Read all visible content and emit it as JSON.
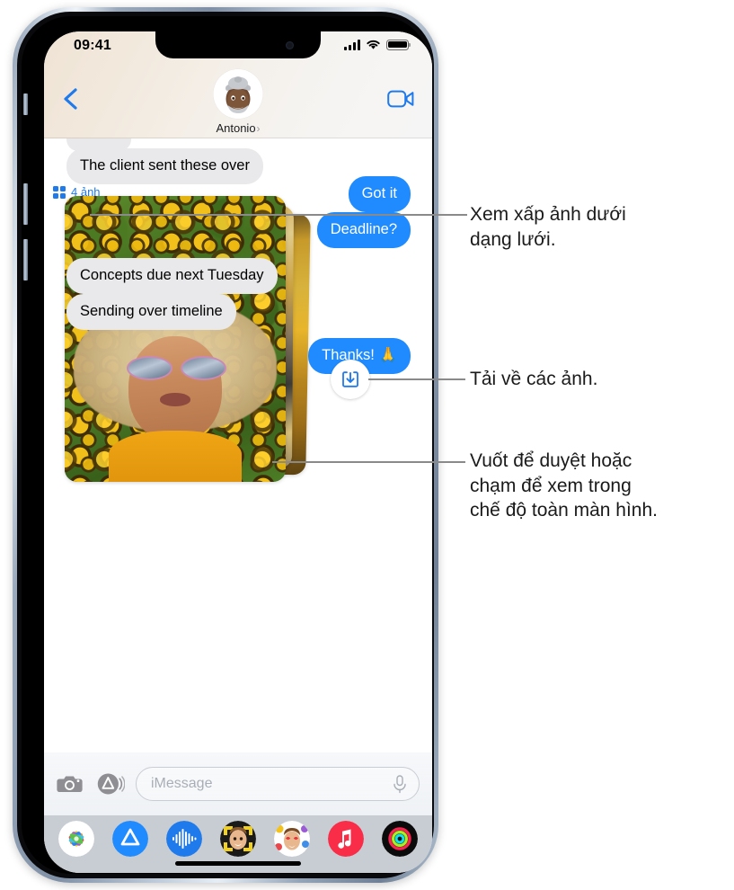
{
  "status_bar": {
    "time": "09:41",
    "signal_icon": "cellular-signal-icon",
    "wifi_icon": "wifi-icon",
    "battery_icon": "battery-icon"
  },
  "nav_bar": {
    "back_icon": "back-chevron-icon",
    "facetime_icon": "facetime-video-icon",
    "contact_name": "Antonio",
    "contact_chevron": "›",
    "avatar_icon": "memoji-avatar-icon"
  },
  "conversation": {
    "messages": [
      {
        "id": "cut",
        "text": "",
        "side": "in",
        "partial": true
      },
      {
        "id": "m1",
        "text": "The client sent these over",
        "side": "in"
      },
      {
        "id": "m2",
        "text": "Got it",
        "side": "out"
      },
      {
        "id": "m3",
        "text": "Deadline?",
        "side": "out"
      },
      {
        "id": "m4",
        "text": "Concepts due next Tuesday",
        "side": "in"
      },
      {
        "id": "m5",
        "text": "Sending over timeline",
        "side": "in"
      },
      {
        "id": "m6",
        "text": "Thanks! 🙏",
        "side": "out"
      }
    ],
    "photo_stack": {
      "grid_label": "4 ảnh",
      "grid_icon": "grid-2x2-icon",
      "count": 4,
      "download_icon": "download-to-tray-icon"
    }
  },
  "input_bar": {
    "camera_icon": "camera-icon",
    "apps_icon": "app-store-icon",
    "placeholder": "iMessage",
    "mic_icon": "microphone-icon"
  },
  "app_drawer": {
    "items": [
      {
        "icon": "photos-app-icon",
        "label": "Photos"
      },
      {
        "icon": "app-store-icon",
        "label": "App Store"
      },
      {
        "icon": "audio-message-icon",
        "label": "Audio"
      },
      {
        "icon": "memoji-app-icon",
        "label": "Memoji"
      },
      {
        "icon": "stickers-app-icon",
        "label": "Stickers"
      },
      {
        "icon": "music-app-icon",
        "label": "Music"
      },
      {
        "icon": "activity-app-icon",
        "label": "Activity"
      }
    ]
  },
  "callouts": [
    {
      "id": "co-1",
      "text": "Xem xấp ảnh dưới\ndạng lưới."
    },
    {
      "id": "co-2",
      "text": "Tải về các ảnh."
    },
    {
      "id": "co-3",
      "text": "Vuốt để duyệt hoặc\nchạm để xem trong\nchế độ toàn màn hình."
    }
  ],
  "colors": {
    "accent_blue": "#1f8bff",
    "link_blue": "#1f7aec",
    "incoming_bubble": "#e9e9eb",
    "outgoing_bubble": "#1f8bff",
    "leader_line": "#8a8a8a",
    "app_drawer_bg": "#c8cdd4"
  }
}
